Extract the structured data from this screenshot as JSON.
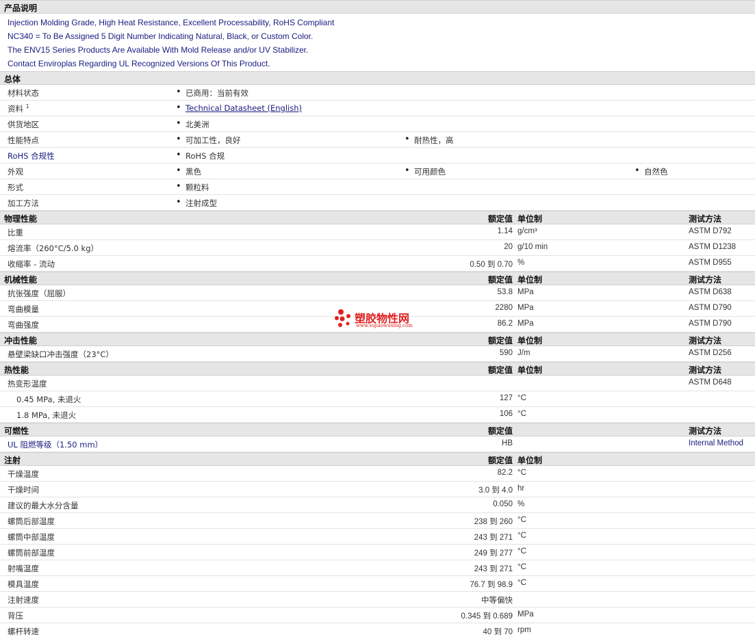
{
  "sections": {
    "product_desc": {
      "title": "产品说明"
    },
    "general": {
      "title": "总体"
    },
    "physical": {
      "title": "物理性能",
      "nominal": "额定值",
      "unit": "单位制",
      "method": "测试方法"
    },
    "mechanical": {
      "title": "机械性能",
      "nominal": "额定值",
      "unit": "单位制",
      "method": "测试方法"
    },
    "impact": {
      "title": "冲击性能",
      "nominal": "额定值",
      "unit": "单位制",
      "method": "测试方法"
    },
    "thermal": {
      "title": "热性能",
      "nominal": "额定值",
      "unit": "单位制",
      "method": "测试方法"
    },
    "flammability": {
      "title": "可燃性",
      "nominal": "额定值",
      "method": "测试方法"
    },
    "injection": {
      "title": "注射",
      "nominal": "额定值",
      "unit": "单位制"
    }
  },
  "description": [
    "Injection Molding Grade, High Heat Resistance, Excellent Processability, RoHS Compliant",
    "NC340 = To Be Assigned 5 Digit Number Indicating Natural, Black, or Custom Color.",
    "The ENV15 Series Products Are Available With Mold Release and/or UV Stabilizer.",
    "Contact Enviroplas Regarding UL Recognized Versions Of This Product."
  ],
  "general": [
    {
      "label": "材料状态",
      "values": [
        "已商用：当前有效"
      ]
    },
    {
      "label": "资料",
      "sup": "1",
      "link": "Technical Datasheet (English)"
    },
    {
      "label": "供货地区",
      "values": [
        "北美洲"
      ]
    },
    {
      "label": "性能特点",
      "values": [
        "可加工性，良好",
        "耐热性，高"
      ]
    },
    {
      "label": "RoHS 合规性",
      "values": [
        "RoHS 合规"
      ]
    },
    {
      "label": "外观",
      "values": [
        "黑色",
        "可用颜色",
        "自然色"
      ]
    },
    {
      "label": "形式",
      "values": [
        "颗粒料"
      ]
    },
    {
      "label": "加工方法",
      "values": [
        "注射成型"
      ]
    }
  ],
  "physical": [
    {
      "label": "比重",
      "value": "1.14",
      "unit": "g/cm³",
      "method": "ASTM D792"
    },
    {
      "label": "熔流率（260°C/5.0 kg）",
      "value": "20",
      "unit": "g/10 min",
      "method": "ASTM D1238"
    },
    {
      "label": "收缩率 - 流动",
      "value": "0.50 到  0.70",
      "unit": "%",
      "method": "ASTM D955"
    }
  ],
  "mechanical": [
    {
      "label": "抗张强度（屈服）",
      "value": "53.8",
      "unit": "MPa",
      "method": "ASTM D638"
    },
    {
      "label": "弯曲模量",
      "value": "2280",
      "unit": "MPa",
      "method": "ASTM D790"
    },
    {
      "label": "弯曲强度",
      "value": "86.2",
      "unit": "MPa",
      "method": "ASTM D790"
    }
  ],
  "impact": [
    {
      "label": "悬壁梁缺口冲击强度（23°C）",
      "value": "590",
      "unit": "J/m",
      "method": "ASTM D256"
    }
  ],
  "thermal": [
    {
      "label": "热变形温度",
      "method": "ASTM D648"
    },
    {
      "label": "0.45 MPa, 未退火",
      "value": "127",
      "unit": "°C"
    },
    {
      "label": "1.8 MPa, 未退火",
      "value": "106",
      "unit": "°C"
    }
  ],
  "flammability": [
    {
      "label": "UL 阻燃等级（1.50 mm）",
      "value": "HB",
      "method": "Internal Method"
    }
  ],
  "injection": [
    {
      "label": "干燥温度",
      "value": "82.2",
      "unit": "°C"
    },
    {
      "label": "干燥时间",
      "value": "3.0 到  4.0",
      "unit": "hr"
    },
    {
      "label": "建议的最大水分含量",
      "value": "0.050",
      "unit": "%"
    },
    {
      "label": "螺筒后部温度",
      "value": "238 到  260",
      "unit": "°C"
    },
    {
      "label": "螺筒中部温度",
      "value": "243 到  271",
      "unit": "°C"
    },
    {
      "label": "螺筒前部温度",
      "value": "249 到  277",
      "unit": "°C"
    },
    {
      "label": "射嘴温度",
      "value": "243 到  271",
      "unit": "°C"
    },
    {
      "label": "模具温度",
      "value": "76.7 到  98.9",
      "unit": "°C"
    },
    {
      "label": "注射速度",
      "value": "中等偏快"
    },
    {
      "label": "背压",
      "value": "0.345 到  0.689",
      "unit": "MPa"
    },
    {
      "label": "螺杆转速",
      "value": "40 到  70",
      "unit": "rpm"
    }
  ],
  "watermark": {
    "text": "塑胶物性网",
    "url": "www.sujiaowuxing.com",
    "color": "#e02020"
  }
}
